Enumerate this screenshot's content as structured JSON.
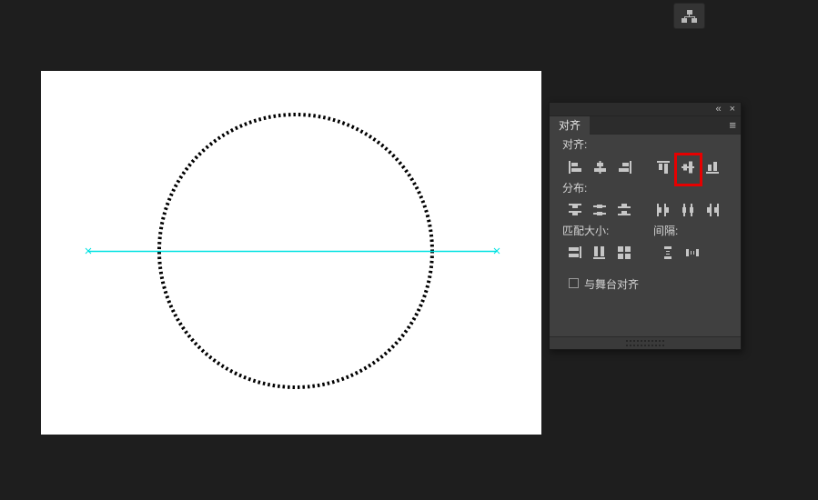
{
  "app": {
    "background_color": "#1e1e1e"
  },
  "dock": {
    "align_panel_button_icon": "align-panel-icon"
  },
  "stage": {
    "background_color": "#ffffff",
    "contents": {
      "shape": "circle-outline-selected",
      "selection_stroke_color": "#000000",
      "guide_line": "horizontal-line",
      "guide_line_color": "#00e2e2"
    }
  },
  "panel": {
    "title": "对齐",
    "titlebar": {
      "collapse_icon": "«",
      "close_icon": "×",
      "menu_icon": "≡"
    },
    "sections": {
      "align": {
        "label": "对齐:",
        "buttons": [
          "align-left-edge",
          "align-horizontal-center",
          "align-right-edge",
          "align-top-edge",
          "align-vertical-center",
          "align-bottom-edge"
        ]
      },
      "distribute": {
        "label": "分布:",
        "buttons": [
          "distribute-top-edge",
          "distribute-vertical-center",
          "distribute-bottom-edge",
          "distribute-left-edge",
          "distribute-horizontal-center",
          "distribute-right-edge"
        ]
      },
      "match": {
        "label": "匹配大小:",
        "buttons": [
          "match-width",
          "match-height",
          "match-width-and-height"
        ]
      },
      "space": {
        "label": "间隔:",
        "buttons": [
          "space-evenly-vertically",
          "space-evenly-horizontally"
        ]
      }
    },
    "align_to_stage": {
      "label": "与舞台对齐",
      "checked": false
    },
    "highlight": {
      "color": "#e60000",
      "target": "align-vertical-center"
    }
  }
}
